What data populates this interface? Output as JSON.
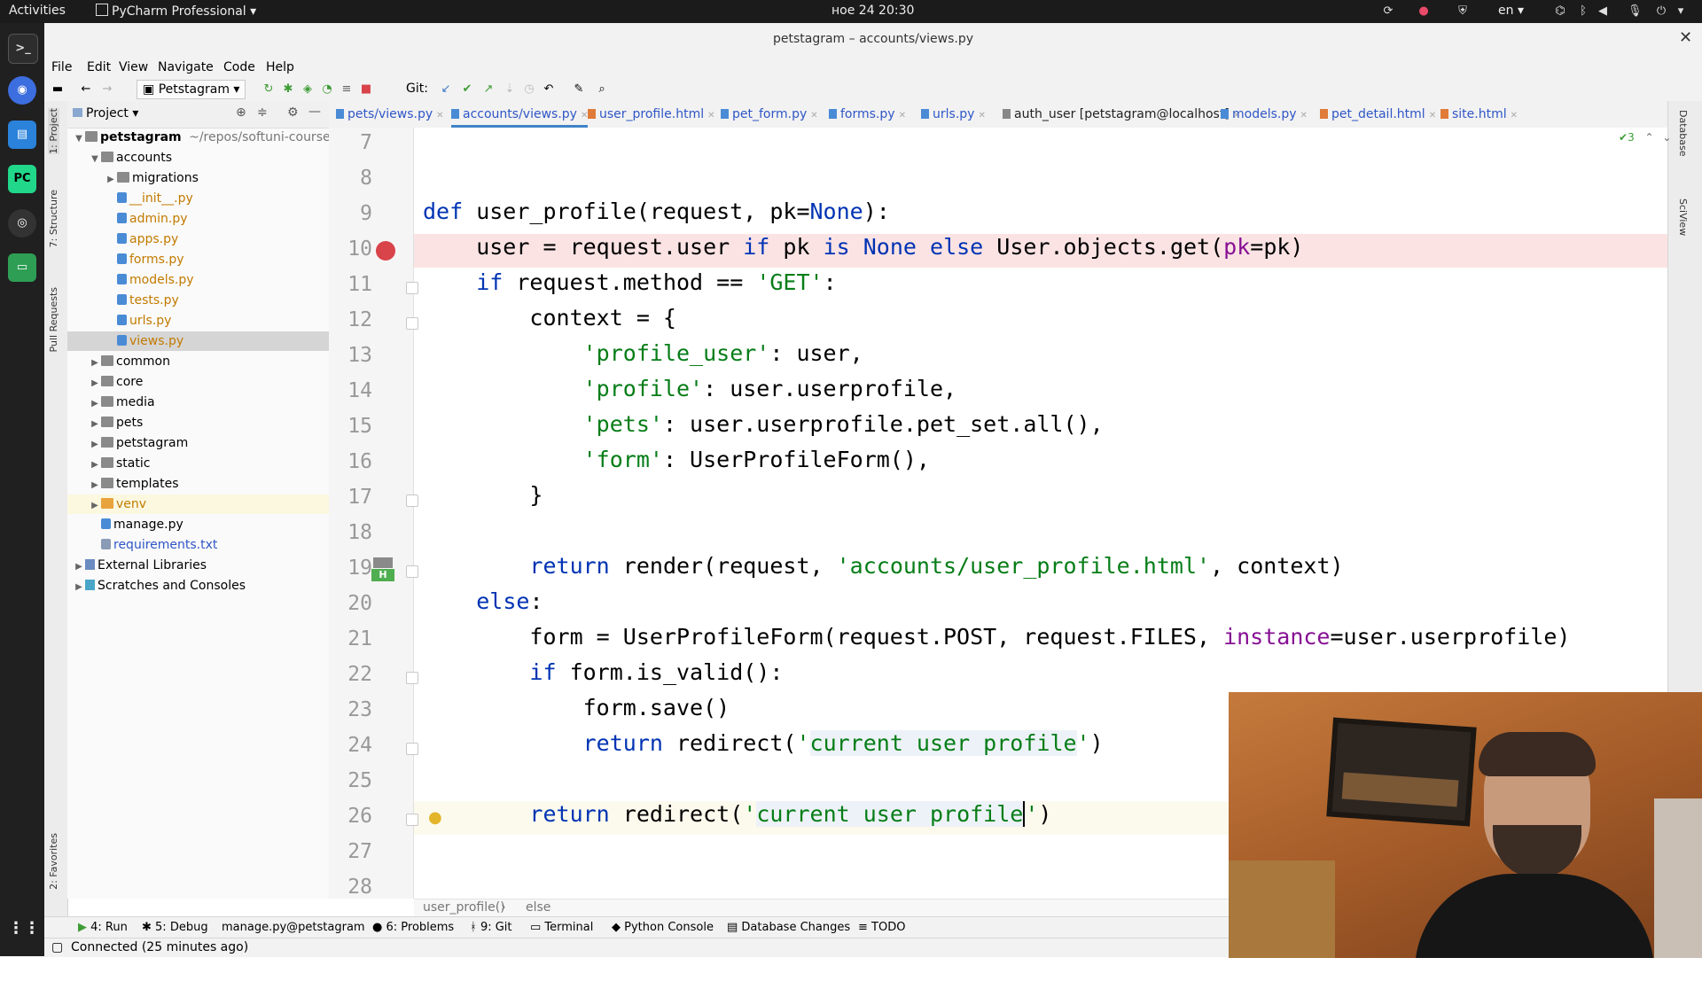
{
  "topbar": {
    "activities": "Activities",
    "app_name": "PyCharm Professional",
    "clock": "ное 24  20:30",
    "language": "en"
  },
  "window": {
    "title": "petstagram – accounts/views.py"
  },
  "menu": [
    "File",
    "Edit",
    "View",
    "Navigate",
    "Code",
    "Help"
  ],
  "toolbar": {
    "run_config": "Petstagram",
    "git_label": "Git:"
  },
  "left_tabs": [
    "1: Project",
    "7: Structure",
    "Pull Requests",
    "2: Favorites"
  ],
  "right_tabs": [
    "Database",
    "SciView"
  ],
  "project": {
    "header": "Project",
    "root_name": "petstagram",
    "root_path": "~/repos/softuni-courses/",
    "tree": [
      {
        "label": "accounts",
        "type": "folder",
        "depth": 1,
        "open": true
      },
      {
        "label": "migrations",
        "type": "folder",
        "depth": 2,
        "open": false
      },
      {
        "label": "__init__.py",
        "type": "py",
        "depth": 2
      },
      {
        "label": "admin.py",
        "type": "py",
        "depth": 2
      },
      {
        "label": "apps.py",
        "type": "py",
        "depth": 2
      },
      {
        "label": "forms.py",
        "type": "py",
        "depth": 2
      },
      {
        "label": "models.py",
        "type": "py",
        "depth": 2
      },
      {
        "label": "tests.py",
        "type": "py",
        "depth": 2
      },
      {
        "label": "urls.py",
        "type": "py",
        "depth": 2
      },
      {
        "label": "views.py",
        "type": "py",
        "depth": 2,
        "selected": true
      },
      {
        "label": "common",
        "type": "folder",
        "depth": 1,
        "open": false
      },
      {
        "label": "core",
        "type": "folder",
        "depth": 1,
        "open": false
      },
      {
        "label": "media",
        "type": "folder",
        "depth": 1,
        "open": false
      },
      {
        "label": "pets",
        "type": "folder",
        "depth": 1,
        "open": false
      },
      {
        "label": "petstagram",
        "type": "folder",
        "depth": 1,
        "open": false
      },
      {
        "label": "static",
        "type": "folder",
        "depth": 1,
        "open": false
      },
      {
        "label": "templates",
        "type": "folder",
        "depth": 1,
        "open": false
      },
      {
        "label": "venv",
        "type": "folder-orange",
        "depth": 1,
        "open": false
      },
      {
        "label": "manage.py",
        "type": "py-plain",
        "depth": 1
      },
      {
        "label": "requirements.txt",
        "type": "txt",
        "depth": 1
      },
      {
        "label": "External Libraries",
        "type": "lib",
        "depth": 0,
        "open": false
      },
      {
        "label": "Scratches and Consoles",
        "type": "scratch",
        "depth": 0,
        "open": false
      }
    ]
  },
  "tabs": [
    {
      "label": "pets/views.py",
      "active": false
    },
    {
      "label": "accounts/views.py",
      "active": true
    },
    {
      "label": "user_profile.html",
      "active": false
    },
    {
      "label": "pet_form.py",
      "active": false
    },
    {
      "label": "forms.py",
      "active": false
    },
    {
      "label": "urls.py",
      "active": false
    },
    {
      "label": "auth_user [petstagram@localhost]",
      "active": false
    },
    {
      "label": "models.py",
      "active": false
    },
    {
      "label": "pet_detail.html",
      "active": false
    },
    {
      "label": "site.html",
      "active": false
    }
  ],
  "inspection_count": "3",
  "editor": {
    "line_numbers": [
      "7",
      "8",
      "9",
      "10",
      "11",
      "12",
      "13",
      "14",
      "15",
      "16",
      "17",
      "18",
      "19",
      "20",
      "21",
      "22",
      "23",
      "24",
      "25",
      "26",
      "27",
      "28"
    ],
    "breakpoint_line": "10",
    "html_marker": "H"
  },
  "breadcrumb": [
    "user_profile()",
    "else"
  ],
  "tool_windows": [
    "4: Run",
    "5: Debug",
    "manage.py@petstagram",
    "6: Problems",
    "9: Git",
    "Terminal",
    "Python Console",
    "Database Changes",
    "TODO"
  ],
  "status": {
    "message": "Connected (25 minutes ago)"
  },
  "colors": {
    "keyword": "#0033b3",
    "string": "#067d17",
    "kwarg": "#871094",
    "breakpoint": "#d9434a",
    "active_tab_underline": "#4083c9"
  }
}
